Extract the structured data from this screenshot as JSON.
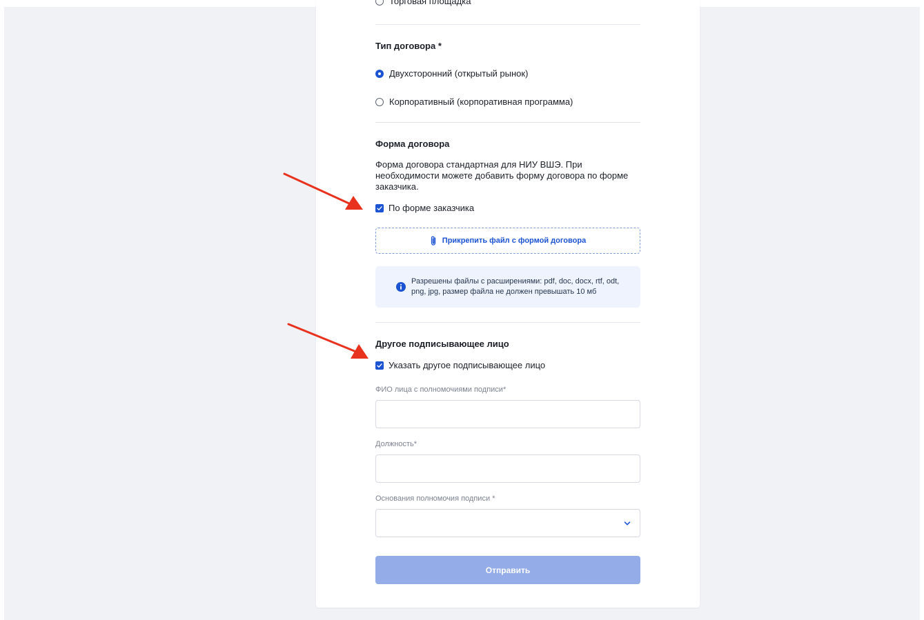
{
  "top_cut_option": {
    "label": "Торговая площадка"
  },
  "contract_type": {
    "title": "Тип договора *",
    "options": [
      {
        "label": "Двухсторонний (открытый рынок)",
        "checked": true
      },
      {
        "label": "Корпоративный (корпоративная программа)",
        "checked": false
      }
    ]
  },
  "contract_form": {
    "title": "Форма договора",
    "description": "Форма договора стандартная для НИУ ВШЭ. При необходимости можете добавить форму договора по форме заказчика.",
    "checkbox_label": "По форме заказчика",
    "checkbox_checked": true,
    "attach_label": "Прикрепить файл с формой договора",
    "info_text": "Разрешены файлы с расширениями: pdf, doc, docx, rtf, odt, png, jpg, размер файла не должен превышать 10 мб"
  },
  "other_signer": {
    "title": "Другое подписывающее лицо",
    "checkbox_label": "Указать другое подписывающее лицо",
    "checkbox_checked": true,
    "fields": {
      "fio_label": "ФИО лица с полномочиями подписи*",
      "fio_value": "",
      "position_label": "Должность*",
      "position_value": "",
      "basis_label": "Основания полномочия подписи *",
      "basis_value": ""
    }
  },
  "submit_label": "Отправить",
  "colors": {
    "accent": "#1c53d3",
    "submit_disabled": "#94ade9",
    "info_bg": "#eef3fd",
    "annotation_arrow": "#e8321e",
    "page_bg": "#f0f2f6"
  },
  "icons": [
    "check-icon",
    "paperclip-icon",
    "info-icon",
    "chevron-down-icon",
    "red-arrow-annotation"
  ]
}
